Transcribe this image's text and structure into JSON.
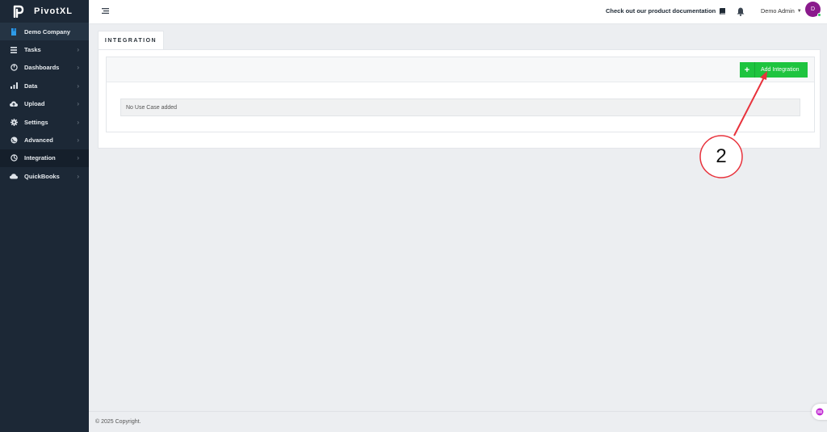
{
  "app": {
    "name": "PivotXL"
  },
  "sidebar": {
    "items": [
      {
        "label": "Demo Company",
        "icon": "bookmark-icon",
        "chevron": ""
      },
      {
        "label": "Tasks",
        "icon": "tasks-icon",
        "chevron": "›"
      },
      {
        "label": "Dashboards",
        "icon": "dashboard-icon",
        "chevron": "›"
      },
      {
        "label": "Data",
        "icon": "bar-chart-icon",
        "chevron": "›"
      },
      {
        "label": "Upload",
        "icon": "upload-cloud-icon",
        "chevron": "›"
      },
      {
        "label": "Settings",
        "icon": "gear-icon",
        "chevron": "›"
      },
      {
        "label": "Advanced",
        "icon": "globe-icon",
        "chevron": "›"
      },
      {
        "label": "Integration",
        "icon": "integration-icon",
        "chevron": "›",
        "active": true
      },
      {
        "label": "QuickBooks",
        "icon": "cloud-icon",
        "chevron": "›"
      }
    ]
  },
  "header": {
    "doc_link": "Check out our product documentation",
    "user_name": "Demo Admin",
    "avatar_initial": "D"
  },
  "main": {
    "tab_label": "INTEGRATION",
    "add_button_label": "Add Integration",
    "add_button_icon": "+",
    "empty_message": "No Use Case added"
  },
  "footer": {
    "copyright": "© 2025 Copyright."
  },
  "annotation": {
    "callout_number": "2"
  },
  "colors": {
    "sidebar_bg": "#1c2836",
    "accent_green": "#1ec43f",
    "avatar_purple": "#8a1a8c",
    "annotation_red": "#e8323c"
  }
}
